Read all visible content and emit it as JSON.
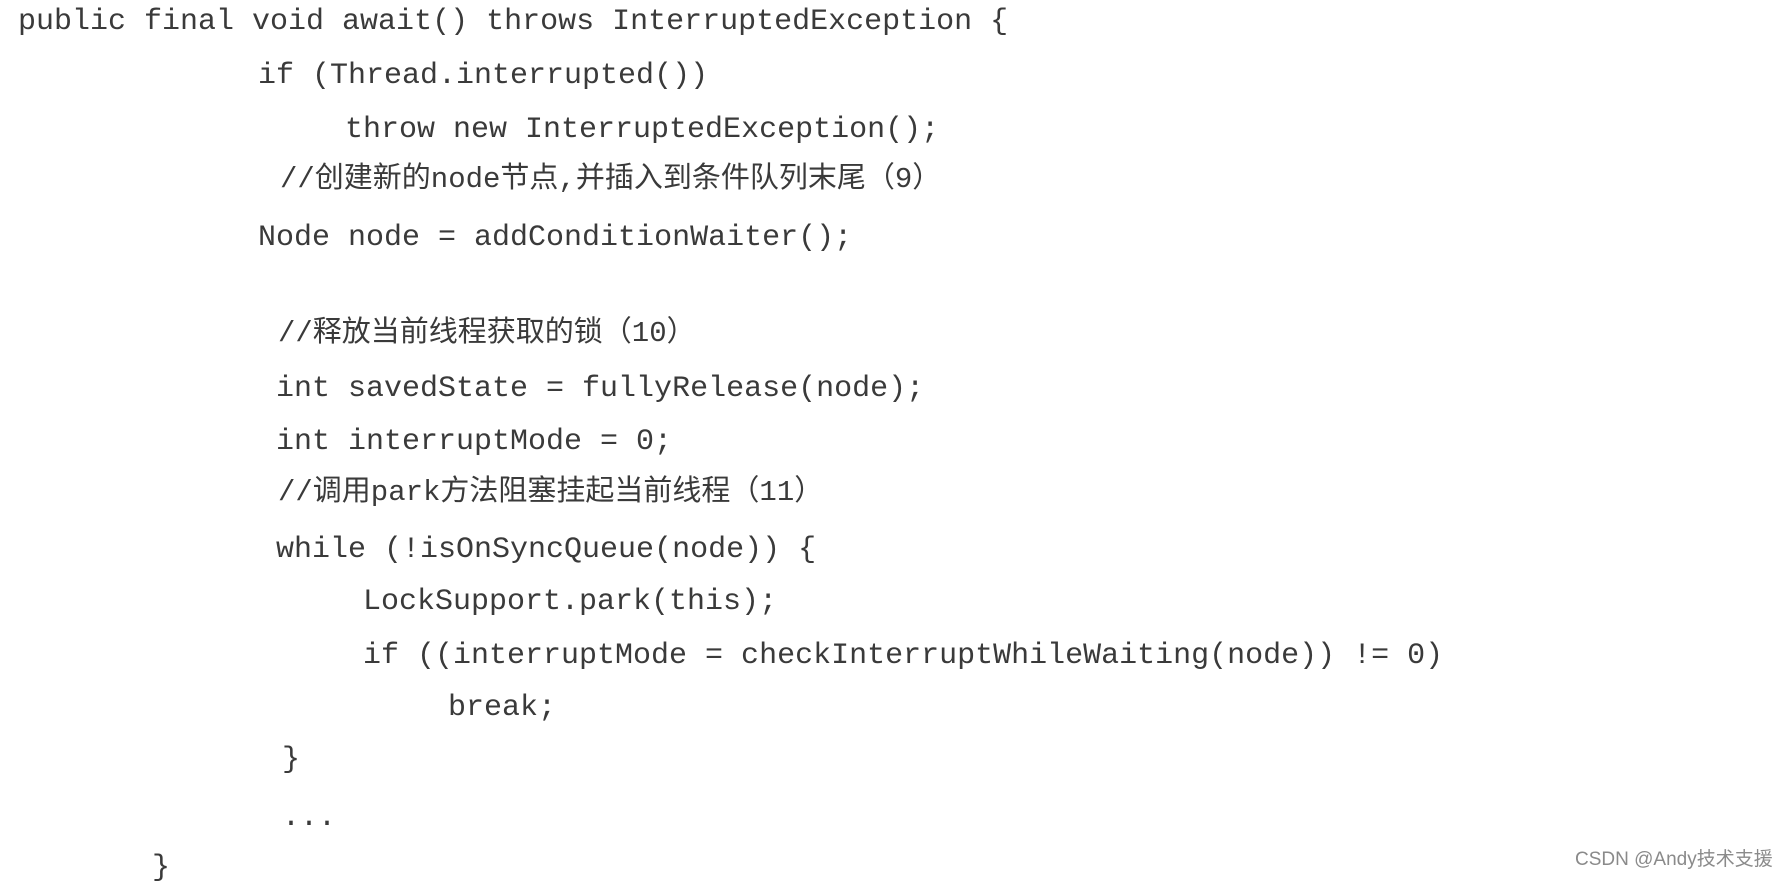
{
  "code_lines": [
    "public final void await() throws InterruptedException {",
    "if (Thread.interrupted())",
    "throw new InterruptedException();",
    "//创建新的node节点,并插入到条件队列末尾（9）",
    "Node node = addConditionWaiter();",
    "//释放当前线程获取的锁（10）",
    "int savedState = fullyRelease(node);",
    "int interruptMode = 0;",
    "//调用park方法阻塞挂起当前线程（11）",
    "while (!isOnSyncQueue(node)) {",
    "LockSupport.park(this);",
    "if ((interruptMode = checkInterruptWhileWaiting(node)) != 0)",
    "break;",
    "}",
    "...",
    "}"
  ],
  "watermark": "CSDN @Andy技术支援"
}
